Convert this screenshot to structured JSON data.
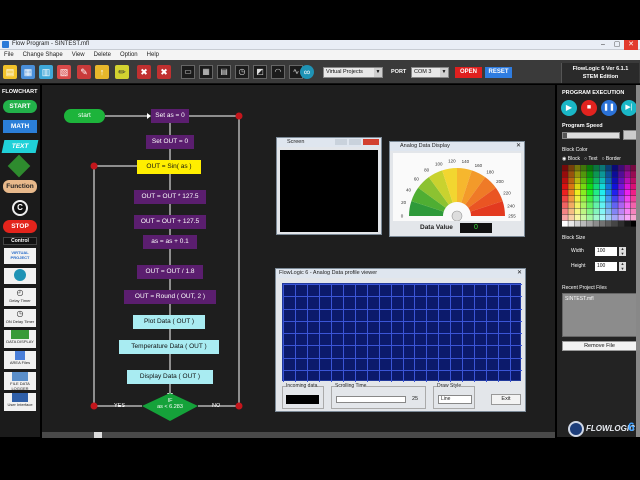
{
  "window": {
    "title": "Flow Program - SINTEST.mfl"
  },
  "menu": [
    "File",
    "Change Shape",
    "View",
    "Delete",
    "Option",
    "Help"
  ],
  "toolbar": {
    "project_select": "Virtual Projects",
    "port_label": "PORT",
    "port_select": "COM 3",
    "open_label": "OPEN",
    "reset_label": "RESET"
  },
  "brand": {
    "line1": "FlowLogic 6  Ver 6.1.1",
    "line2": "STEM Edition"
  },
  "palette": {
    "header": "FLOWCHART",
    "start": "START",
    "math": "MATH",
    "text": "TEXT",
    "function": "Function",
    "c": "C",
    "stop": "STOP",
    "control": "Control",
    "items": [
      "VIRTUAL PROJECT",
      "ARDUINO",
      "Delay Timer",
      "ON Delay Timer",
      "DATA DISPLAY",
      "AREA Files",
      "FILE DATA LOGGER",
      "User Interface"
    ]
  },
  "flow": {
    "start": "start",
    "n1": "Set as = 0",
    "n2": "Set OUT = 0",
    "n3": "OUT = Sin( as )",
    "n4": "OUT = OUT * 127.5",
    "n5": "OUT = OUT + 127.5",
    "n6": "as = as + 0.1",
    "n7": "OUT = OUT / 1.8",
    "n8": "OUT = Round ( OUT, 2 )",
    "n9": "Plot Data ( OUT )",
    "n10": "Temperature Data ( OUT )",
    "n11": "Display Data ( OUT )",
    "decision_l1": "IF",
    "decision_l2": "as < 6.283",
    "yes": "YES",
    "no": "NO"
  },
  "screen_window": {
    "title": "Screen"
  },
  "gauge_window": {
    "title": "Analog Data Display",
    "ticks": [
      "0",
      "20",
      "40",
      "60",
      "80",
      "100",
      "120",
      "140",
      "160",
      "180",
      "200",
      "220",
      "240",
      "255"
    ],
    "value_label": "Data Value",
    "value": "0"
  },
  "profile_window": {
    "title": "FlowLogic 6 - Analog Data profile viewer",
    "incoming_label": "Incoming data",
    "scrolling_label": "Scrolling Time",
    "scrolling_value": "25",
    "draw_style_label": "Draw Style",
    "draw_style_value": "Line",
    "exit_label": "Exit"
  },
  "right_panel": {
    "exec_title": "PROGRAM EXECUTION",
    "speed_label": "Program Speed",
    "block_color_label": "Block Color",
    "radio_block": "Block",
    "radio_text": "Text",
    "radio_border": "Border",
    "block_size_label": "Block Size",
    "width_label": "Width",
    "width_value": "100",
    "height_label": "Height",
    "height_value": "100",
    "recent_label": "Recent Project Files",
    "recent_file": "SINTEST.mfl",
    "remove_label": "Remove File"
  },
  "watermark": "FLOWLOGIC",
  "watermark_num": "6",
  "colors": {
    "node": "#5b1e6f",
    "start_node": "#1db43b",
    "highlight": "#ffee00",
    "output_node": "#a9ecf2",
    "arrow": "#ffffff",
    "junction": "#c4161c",
    "decision": "#15a23a"
  }
}
